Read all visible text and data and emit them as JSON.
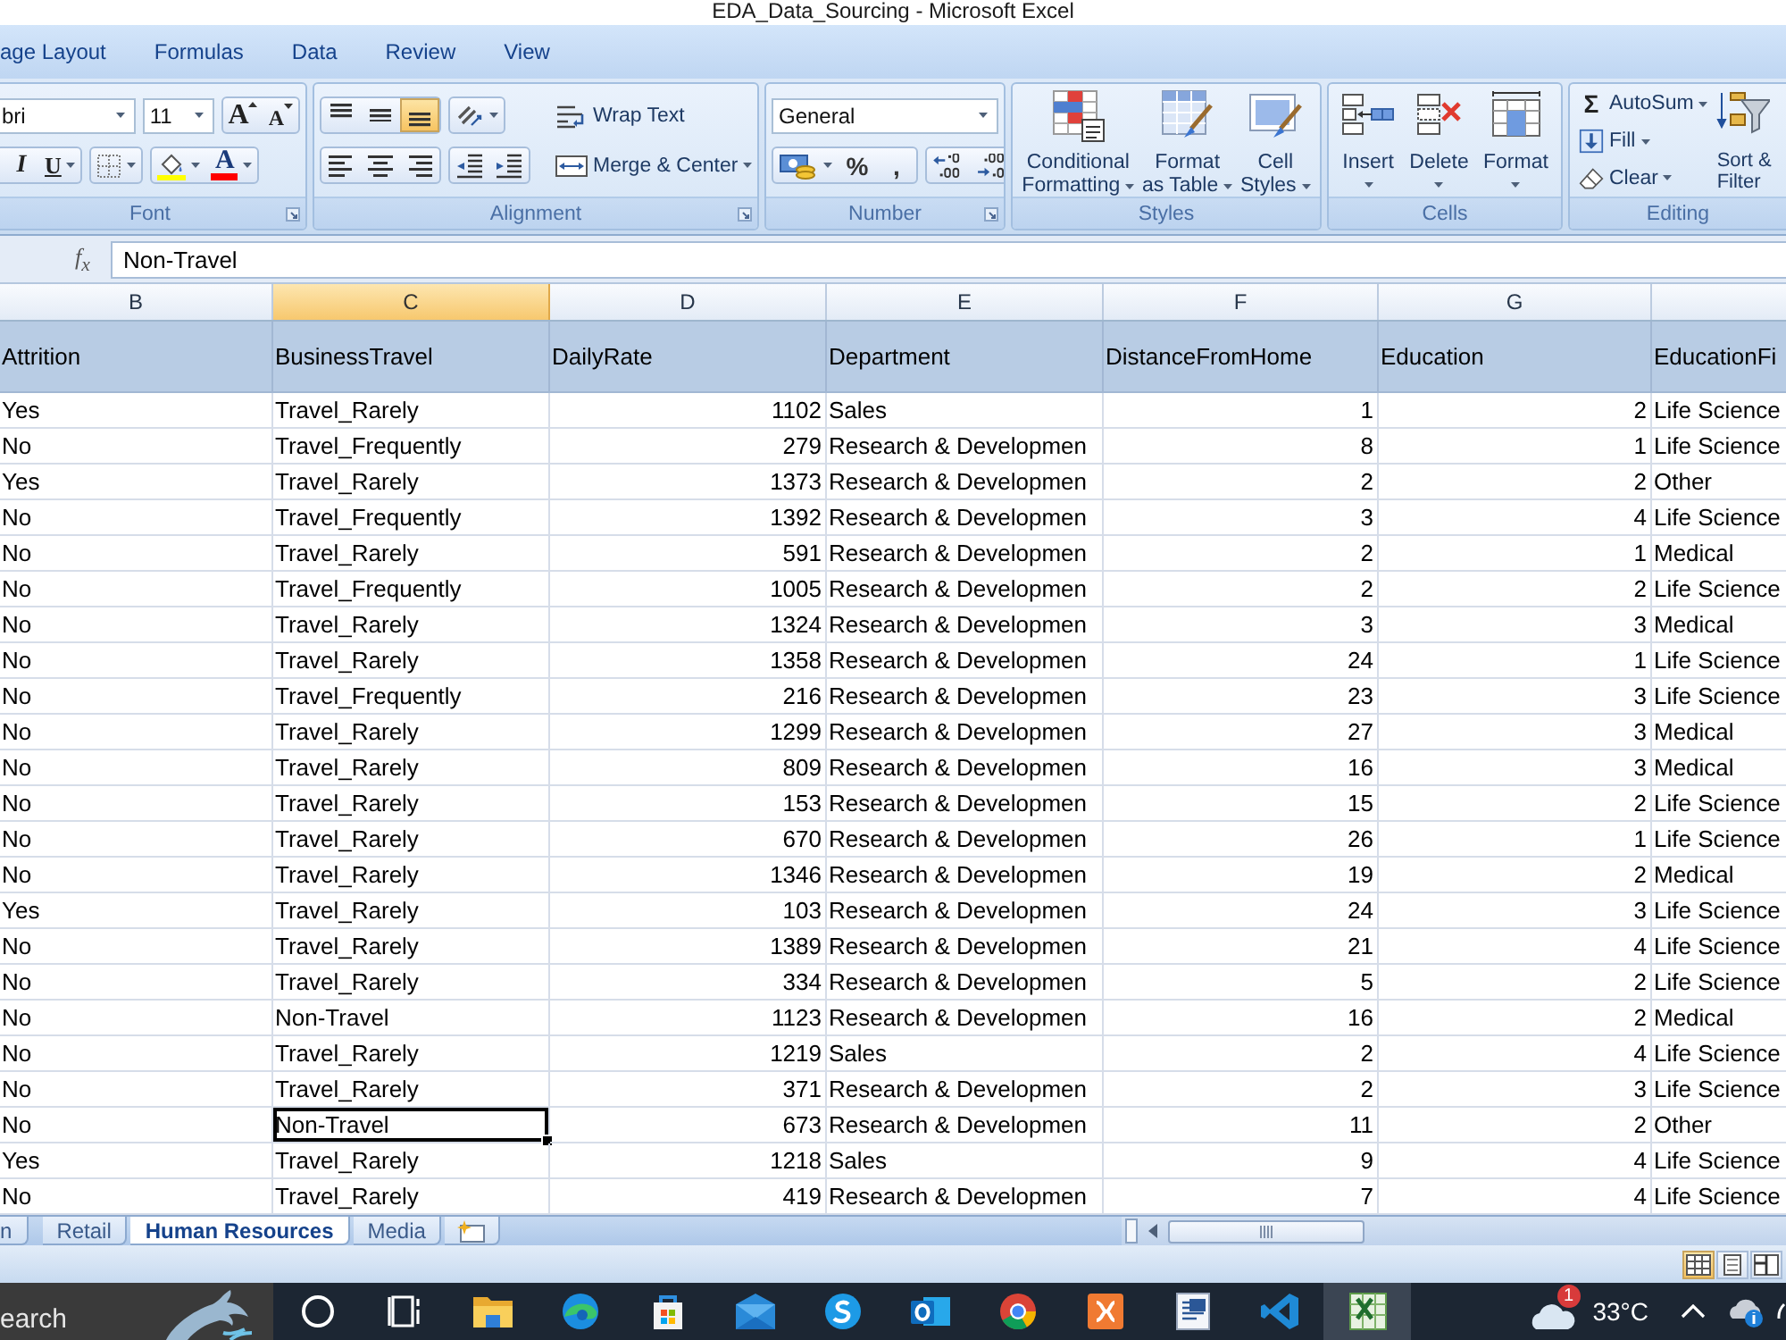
{
  "window": {
    "title": "EDA_Data_Sourcing - Microsoft Excel"
  },
  "ribbon": {
    "tabs": [
      {
        "label": "age Layout",
        "selected": false
      },
      {
        "label": "Formulas",
        "selected": false
      },
      {
        "label": "Data",
        "selected": false
      },
      {
        "label": "Review",
        "selected": false
      },
      {
        "label": "View",
        "selected": false
      }
    ],
    "font_group": {
      "label": "Font",
      "font_name": "bri",
      "font_size": "11",
      "grow_font": "A",
      "shrink_font": "A",
      "italic": "I",
      "underline": "U",
      "font_color": "A"
    },
    "alignment_group": {
      "label": "Alignment",
      "vertical_align": [
        {
          "kind": "top",
          "selected": false
        },
        {
          "kind": "middle",
          "selected": false
        },
        {
          "kind": "bottom",
          "selected": true
        }
      ],
      "horizontal_align": [
        {
          "kind": "left",
          "selected": false
        },
        {
          "kind": "center",
          "selected": false
        },
        {
          "kind": "right",
          "selected": false
        }
      ],
      "wrap_text": "Wrap Text",
      "merge_center": "Merge & Center"
    },
    "number_group": {
      "label": "Number",
      "format": "General",
      "percent": "%",
      "comma": ","
    },
    "styles_group": {
      "label": "Styles",
      "buttons": [
        {
          "kind": "conditional",
          "lines": [
            "Conditional",
            "Formatting"
          ]
        },
        {
          "kind": "table",
          "lines": [
            "Format",
            "as Table"
          ]
        },
        {
          "kind": "cellstyles",
          "lines": [
            "Cell",
            "Styles"
          ]
        }
      ]
    },
    "cells_group": {
      "label": "Cells",
      "buttons": [
        {
          "kind": "insert",
          "label": "Insert"
        },
        {
          "kind": "delete",
          "label": "Delete"
        },
        {
          "kind": "format",
          "label": "Format"
        }
      ]
    },
    "editing_group": {
      "label": "Editing",
      "sum_symbol": "Σ",
      "autosum": "AutoSum",
      "fill": "Fill",
      "clear": "Clear",
      "sort_lines": [
        "Sort &",
        "Filter"
      ]
    }
  },
  "formula_bar": {
    "fx_label": "f$_{x}$",
    "value": "Non-Travel"
  },
  "sheet": {
    "columns": [
      {
        "letter": "B",
        "selected": false,
        "kind": "text"
      },
      {
        "letter": "C",
        "selected": true,
        "kind": "text"
      },
      {
        "letter": "D",
        "selected": false,
        "kind": "number"
      },
      {
        "letter": "E",
        "selected": false,
        "kind": "text"
      },
      {
        "letter": "F",
        "selected": false,
        "kind": "number"
      },
      {
        "letter": "G",
        "selected": false,
        "kind": "number"
      },
      {
        "kind": "text"
      }
    ],
    "header_row": [
      "Attrition",
      "BusinessTravel",
      "DailyRate",
      "Department",
      "DistanceFromHome",
      "Education",
      "EducationFi"
    ],
    "rows": [
      {
        "selected": false,
        "cells": [
          "Yes",
          "Travel_Rarely",
          "1102",
          "Sales",
          "1",
          "2",
          "Life Science"
        ]
      },
      {
        "selected": false,
        "cells": [
          "No",
          "Travel_Frequently",
          "279",
          "Research & Developmen",
          "8",
          "1",
          "Life Science"
        ]
      },
      {
        "selected": false,
        "cells": [
          "Yes",
          "Travel_Rarely",
          "1373",
          "Research & Developmen",
          "2",
          "2",
          "Other"
        ]
      },
      {
        "selected": false,
        "cells": [
          "No",
          "Travel_Frequently",
          "1392",
          "Research & Developmen",
          "3",
          "4",
          "Life Science"
        ]
      },
      {
        "selected": false,
        "cells": [
          "No",
          "Travel_Rarely",
          "591",
          "Research & Developmen",
          "2",
          "1",
          "Medical"
        ]
      },
      {
        "selected": false,
        "cells": [
          "No",
          "Travel_Frequently",
          "1005",
          "Research & Developmen",
          "2",
          "2",
          "Life Science"
        ]
      },
      {
        "selected": false,
        "cells": [
          "No",
          "Travel_Rarely",
          "1324",
          "Research & Developmen",
          "3",
          "3",
          "Medical"
        ]
      },
      {
        "selected": false,
        "cells": [
          "No",
          "Travel_Rarely",
          "1358",
          "Research & Developmen",
          "24",
          "1",
          "Life Science"
        ]
      },
      {
        "selected": false,
        "cells": [
          "No",
          "Travel_Frequently",
          "216",
          "Research & Developmen",
          "23",
          "3",
          "Life Science"
        ]
      },
      {
        "selected": false,
        "cells": [
          "No",
          "Travel_Rarely",
          "1299",
          "Research & Developmen",
          "27",
          "3",
          "Medical"
        ]
      },
      {
        "selected": false,
        "cells": [
          "No",
          "Travel_Rarely",
          "809",
          "Research & Developmen",
          "16",
          "3",
          "Medical"
        ]
      },
      {
        "selected": false,
        "cells": [
          "No",
          "Travel_Rarely",
          "153",
          "Research & Developmen",
          "15",
          "2",
          "Life Science"
        ]
      },
      {
        "selected": false,
        "cells": [
          "No",
          "Travel_Rarely",
          "670",
          "Research & Developmen",
          "26",
          "1",
          "Life Science"
        ]
      },
      {
        "selected": false,
        "cells": [
          "No",
          "Travel_Rarely",
          "1346",
          "Research & Developmen",
          "19",
          "2",
          "Medical"
        ]
      },
      {
        "selected": false,
        "cells": [
          "Yes",
          "Travel_Rarely",
          "103",
          "Research & Developmen",
          "24",
          "3",
          "Life Science"
        ]
      },
      {
        "selected": false,
        "cells": [
          "No",
          "Travel_Rarely",
          "1389",
          "Research & Developmen",
          "21",
          "4",
          "Life Science"
        ]
      },
      {
        "selected": false,
        "cells": [
          "No",
          "Travel_Rarely",
          "334",
          "Research & Developmen",
          "5",
          "2",
          "Life Science"
        ]
      },
      {
        "selected": false,
        "cells": [
          "No",
          "Non-Travel",
          "1123",
          "Research & Developmen",
          "16",
          "2",
          "Medical"
        ]
      },
      {
        "selected": false,
        "cells": [
          "No",
          "Travel_Rarely",
          "1219",
          "Sales",
          "2",
          "4",
          "Life Science"
        ]
      },
      {
        "selected": false,
        "cells": [
          "No",
          "Travel_Rarely",
          "371",
          "Research & Developmen",
          "2",
          "3",
          "Life Science"
        ]
      },
      {
        "selected": true,
        "cells": [
          "No",
          "Non-Travel",
          "673",
          "Research & Developmen",
          "11",
          "2",
          "Other"
        ]
      },
      {
        "selected": false,
        "cells": [
          "Yes",
          "Travel_Rarely",
          "1218",
          "Sales",
          "9",
          "4",
          "Life Science"
        ]
      },
      {
        "selected": false,
        "cells": [
          "No",
          "Travel_Rarely",
          "419",
          "Research & Developmen",
          "7",
          "4",
          "Life Science"
        ]
      }
    ]
  },
  "sheet_tabs": [
    {
      "label": "n",
      "selected": false
    },
    {
      "label": "Retail",
      "selected": false
    },
    {
      "label": "Human Resources",
      "selected": true
    },
    {
      "label": "Media",
      "selected": false
    }
  ],
  "status_bar": {
    "views": [
      {
        "kind": "normal",
        "selected": true
      },
      {
        "kind": "layout",
        "selected": false
      },
      {
        "kind": "pagebreak",
        "selected": false
      }
    ]
  },
  "taskbar": {
    "search_placeholder": "earch",
    "apps": [
      {
        "kind": "cortana",
        "active": false
      },
      {
        "kind": "taskview",
        "active": false
      },
      {
        "kind": "explorer",
        "active": false
      },
      {
        "kind": "edge",
        "active": false
      },
      {
        "kind": "store",
        "active": false
      },
      {
        "kind": "mail",
        "active": false
      },
      {
        "kind": "skype",
        "active": false
      },
      {
        "kind": "outlook",
        "active": false
      },
      {
        "kind": "chrome",
        "active": false
      },
      {
        "kind": "xampp",
        "active": false
      },
      {
        "kind": "word",
        "active": false
      },
      {
        "kind": "vscode",
        "active": false
      },
      {
        "kind": "excel",
        "active": true
      }
    ],
    "weather": {
      "temperature": "33°C",
      "badge": "1"
    }
  }
}
